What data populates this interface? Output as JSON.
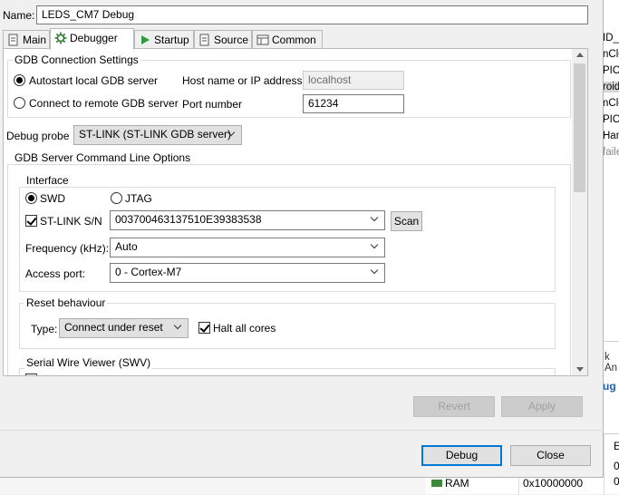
{
  "dialog": {
    "name_label": "Name:",
    "name_value": "LEDS_CM7 Debug"
  },
  "tabs": [
    {
      "label": "Main",
      "icon": "main-doc-icon"
    },
    {
      "label": "Debugger",
      "icon": "debugger-gear-icon"
    },
    {
      "label": "Startup",
      "icon": "startup-play-icon"
    },
    {
      "label": "Source",
      "icon": "source-doc-icon"
    },
    {
      "label": "Common",
      "icon": "common-table-icon"
    }
  ],
  "active_tab": "Debugger",
  "gdb_connection": {
    "title": "GDB Connection Settings",
    "autostart_label": "Autostart local GDB server",
    "remote_label": "Connect to remote GDB server",
    "host_label": "Host name or IP address",
    "host_value": "localhost",
    "port_label": "Port number",
    "port_value": "61234"
  },
  "debug_probe": {
    "label": "Debug probe",
    "value": "ST-LINK (ST-LINK GDB server)"
  },
  "server_options": {
    "title": "GDB Server Command Line Options",
    "interface": {
      "title": "Interface",
      "swd_label": "SWD",
      "jtag_label": "JTAG",
      "serial_label": "ST-LINK S/N",
      "serial_value": "003700463137510E39383538",
      "scan_label": "Scan",
      "frequency_label": "Frequency (kHz):",
      "frequency_value": "Auto",
      "access_port_label": "Access port:",
      "access_port_value": "0 - Cortex-M7"
    },
    "reset": {
      "title": "Reset behaviour",
      "type_label": "Type:",
      "type_value": "Connect under reset",
      "halt_label": "Halt all cores"
    },
    "swv": {
      "title": "Serial Wire Viewer (SWV)"
    }
  },
  "buttons": {
    "revert": "Revert",
    "apply": "Apply",
    "debug": "Debug",
    "close": "Close"
  },
  "background": {
    "code_lines": [
      "ID_",
      "nClo",
      "PIO_",
      "roid",
      "nClo",
      "PIO_",
      "Han",
      "faile"
    ],
    "side_tab": "k An",
    "side_blue": "ug",
    "table_header": "E",
    "table_rows": [
      {
        "name": "",
        "addr": "",
        "c": "0"
      },
      {
        "name": "",
        "addr": "",
        "c": "0"
      },
      {
        "name": "RAM",
        "addr": "0x10000000",
        "c": "0"
      }
    ]
  }
}
